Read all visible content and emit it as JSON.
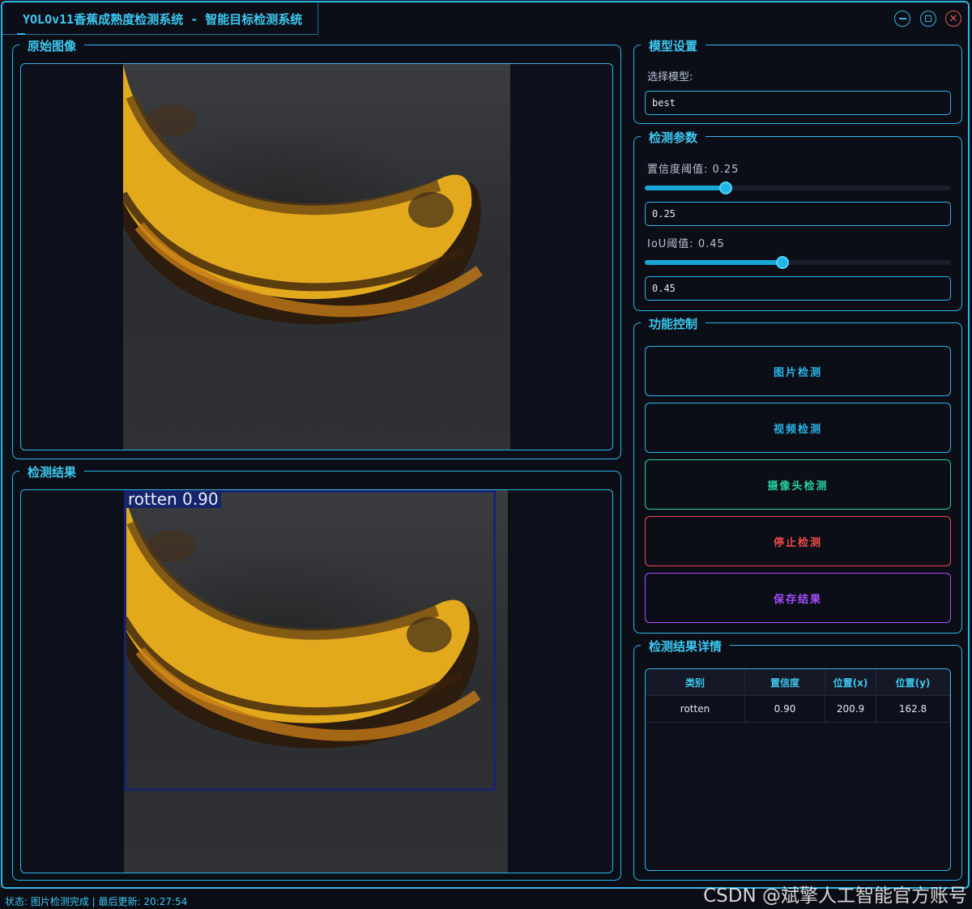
{
  "window": {
    "title": "YOLOv11香蕉成熟度检测系统 - 智能目标检测系统"
  },
  "original_panel": {
    "title": "原始图像"
  },
  "result_panel": {
    "title": "检测结果",
    "detection_label": "rotten 0.90",
    "box_color": "#17246e"
  },
  "model_panel": {
    "title": "模型设置",
    "select_label": "选择模型:",
    "model_value": "best"
  },
  "params_panel": {
    "title": "检测参数",
    "conf_label": "置信度阈值: 0.25",
    "conf_value": "0.25",
    "conf_fraction": 0.25,
    "iou_label": "IoU阈值: 0.45",
    "iou_value": "0.45",
    "iou_fraction": 0.45
  },
  "control_panel": {
    "title": "功能控制",
    "buttons": [
      {
        "label": "图片检测",
        "color": "#2bb6e6"
      },
      {
        "label": "视频检测",
        "color": "#2bb6e6"
      },
      {
        "label": "摄像头检测",
        "color": "#26d3a0"
      },
      {
        "label": "停止检测",
        "color": "#ef4a4a"
      },
      {
        "label": "保存结果",
        "color": "#a64dff"
      }
    ]
  },
  "details_panel": {
    "title": "检测结果详情",
    "columns": [
      "类别",
      "置信度",
      "位置(x)",
      "位置(y)"
    ],
    "rows": [
      [
        "rotten",
        "0.90",
        "200.9",
        "162.8"
      ]
    ]
  },
  "status": {
    "text": "状态: 图片检测完成 | 最后更新: 20:27:54"
  },
  "watermark": "CSDN @斌擎人工智能官方账号",
  "icons": [
    "minimize-icon",
    "maximize-icon",
    "close-icon"
  ]
}
